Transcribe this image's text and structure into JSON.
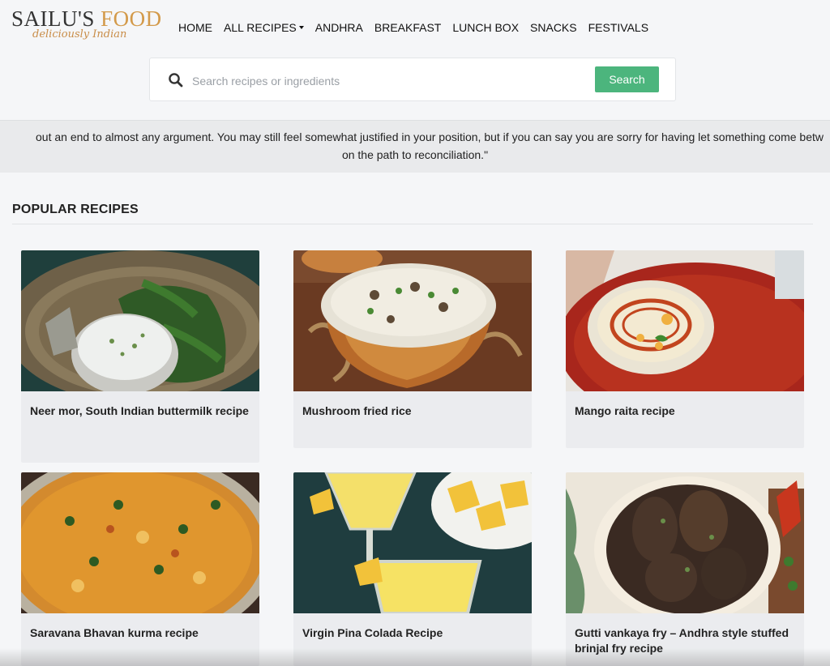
{
  "brand": {
    "logo_part1": "SAILU'S",
    "logo_part2": "FOOD",
    "tagline": "deliciously Indian",
    "accent_color": "#d39a4a"
  },
  "nav": [
    {
      "label": "HOME"
    },
    {
      "label": "ALL RECIPES",
      "has_dropdown": true
    },
    {
      "label": "ANDHRA"
    },
    {
      "label": "BREAKFAST"
    },
    {
      "label": "LUNCH BOX"
    },
    {
      "label": "SNACKS"
    },
    {
      "label": "FESTIVALS"
    }
  ],
  "search": {
    "placeholder": "Search recipes or ingredients",
    "button_label": "Search",
    "button_color": "#4cb57d"
  },
  "quote": {
    "line1": "out an end to almost any argument. You may still feel somewhat justified in your position, but if you can say you are sorry for having let something come betw",
    "line2": "on the path to reconciliation.\""
  },
  "popular": {
    "heading": "POPULAR RECIPES",
    "cards": [
      {
        "title": "Neer mor, South Indian buttermilk recipe",
        "image": "buttermilk-photo"
      },
      {
        "title": "Mushroom fried rice",
        "image": "fried-rice-photo"
      },
      {
        "title": "Mango raita recipe",
        "image": "raita-photo"
      },
      {
        "title": "Saravana Bhavan kurma recipe",
        "image": "kurma-photo"
      },
      {
        "title": "Virgin Pina Colada Recipe",
        "image": "pina-colada-photo"
      },
      {
        "title": "Gutti vankaya fry – Andhra style stuffed brinjal fry recipe",
        "image": "brinjal-fry-photo"
      }
    ]
  }
}
